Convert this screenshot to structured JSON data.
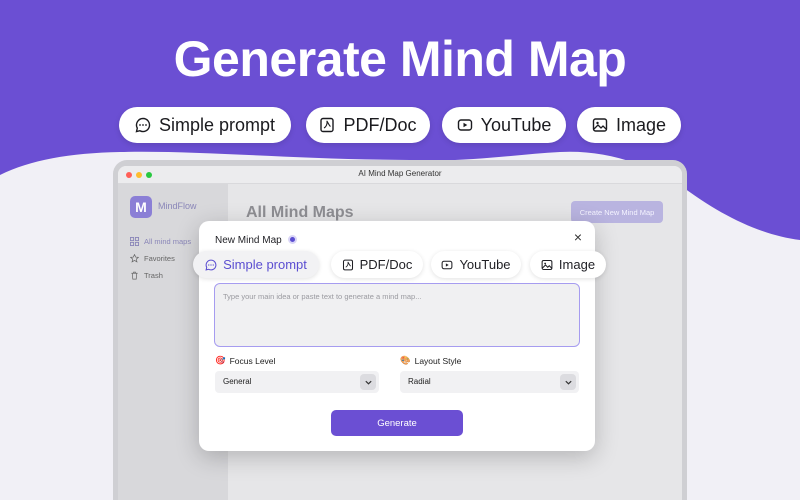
{
  "hero": {
    "title": "Generate Mind Map",
    "chips": [
      {
        "label": "Simple prompt",
        "icon": "chat-bubble-icon"
      },
      {
        "label": "PDF/Doc",
        "icon": "pdf-file-icon"
      },
      {
        "label": "YouTube",
        "icon": "youtube-play-icon"
      },
      {
        "label": "Image",
        "icon": "image-icon"
      }
    ]
  },
  "window": {
    "title": "AI Mind Map Generator",
    "traffic_colors": [
      "#ff5f57",
      "#febc2e",
      "#28c840"
    ]
  },
  "sidebar": {
    "app_name": "MindFlow",
    "logo_letter": "M",
    "items": [
      {
        "label": "All mind maps",
        "icon": "grid-icon",
        "active": true
      },
      {
        "label": "Favorites",
        "icon": "star-icon",
        "active": false
      },
      {
        "label": "Trash",
        "icon": "trash-icon",
        "active": false
      }
    ]
  },
  "main": {
    "title": "All Mind Maps",
    "new_button": "Create New Mind Map"
  },
  "modal": {
    "title": "New Mind Map",
    "close": "×",
    "tabs": [
      {
        "label": "Simple prompt",
        "icon": "chat-bubble-icon",
        "selected": true
      },
      {
        "label": "PDF/Doc",
        "icon": "pdf-file-icon",
        "selected": false
      },
      {
        "label": "YouTube",
        "icon": "youtube-play-icon",
        "selected": false
      },
      {
        "label": "Image",
        "icon": "image-icon",
        "selected": false
      }
    ],
    "prompt_placeholder": "Type your main idea or paste text to generate a mind map...",
    "focus_level": {
      "label": "Focus Level",
      "emoji": "🎯",
      "value": "General"
    },
    "layout_style": {
      "label": "Layout Style",
      "emoji": "🎨",
      "value": "Radial"
    },
    "generate_button": "Generate"
  },
  "colors": {
    "accent": "#6b4fd3",
    "hero_bg": "#6b4fd3",
    "page_bg": "#f1f0f6"
  }
}
